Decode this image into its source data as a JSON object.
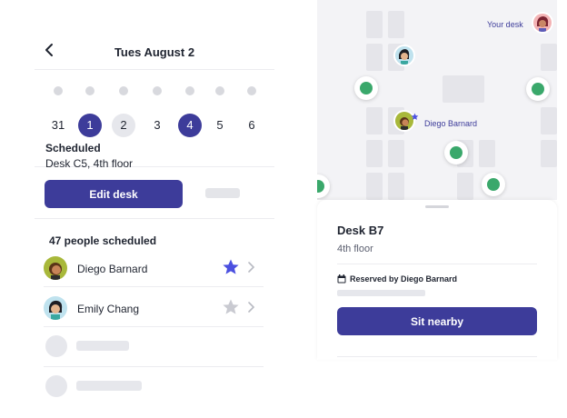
{
  "colors": {
    "accent": "#3d3c9a",
    "available": "#3aa86b",
    "star_active": "#4b50e0",
    "star_inactive": "#c9cad1"
  },
  "header": {
    "title": "Tues August 2",
    "back_icon": "chevron-left-icon"
  },
  "calendar": {
    "days": [
      {
        "label": "31",
        "state": "default"
      },
      {
        "label": "1",
        "state": "scheduled"
      },
      {
        "label": "2",
        "state": "today"
      },
      {
        "label": "3",
        "state": "default"
      },
      {
        "label": "4",
        "state": "scheduled"
      },
      {
        "label": "5",
        "state": "default"
      },
      {
        "label": "6",
        "state": "default"
      }
    ]
  },
  "schedule": {
    "label": "Scheduled",
    "desk": "Desk C5, 4th floor",
    "edit_label": "Edit desk"
  },
  "people": {
    "count_label": "47 people scheduled",
    "list": [
      {
        "name": "Diego Barnard",
        "favorite": true
      },
      {
        "name": "Emily Chang",
        "favorite": false
      }
    ]
  },
  "map": {
    "your_desk_label": "Your desk",
    "person_label": "Diego Barnard"
  },
  "desk_sheet": {
    "name": "Desk B7",
    "floor": "4th floor",
    "reserved_by": "Reserved by Diego Barnard",
    "action_label": "Sit nearby"
  }
}
